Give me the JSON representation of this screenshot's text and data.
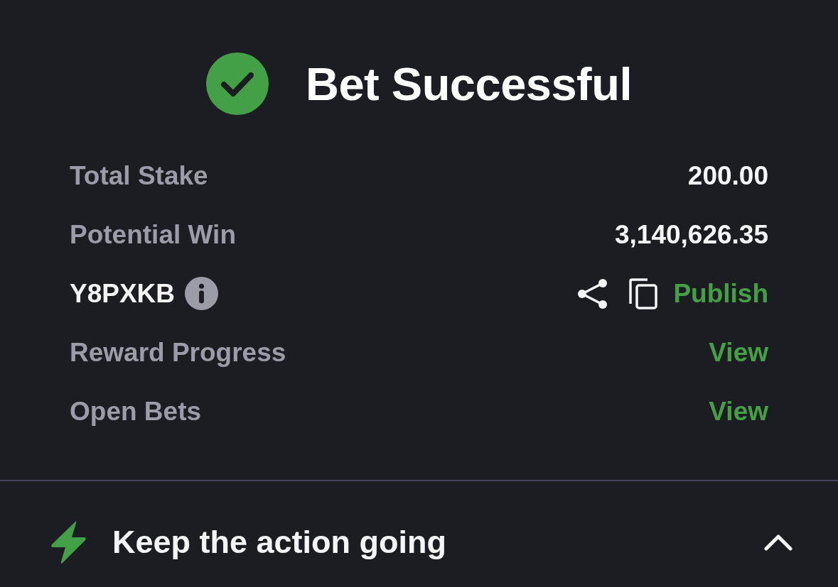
{
  "header": {
    "title": "Bet Successful"
  },
  "summary": [
    {
      "kind": "amount",
      "label": "Total Stake",
      "value": "200.00"
    },
    {
      "kind": "amount",
      "label": "Potential Win",
      "value": "3,140,626.35"
    },
    {
      "kind": "code",
      "code": "Y8PXKB",
      "action": "Publish"
    },
    {
      "kind": "link",
      "label": "Reward Progress",
      "action": "View"
    },
    {
      "kind": "link",
      "label": "Open Bets",
      "action": "View"
    }
  ],
  "promo": {
    "title": "Keep the action going",
    "expanded": true
  }
}
